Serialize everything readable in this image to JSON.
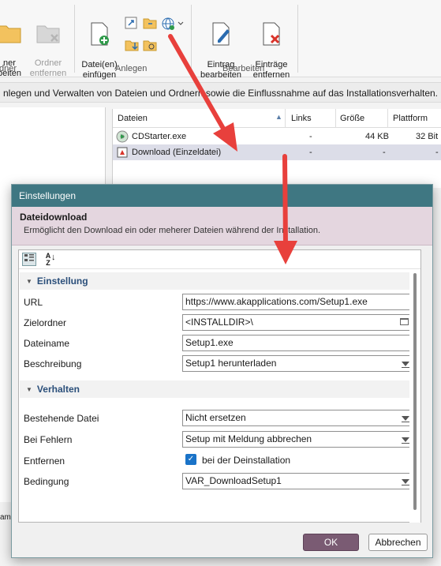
{
  "ribbon": {
    "btn_neuer_ordner": "ner\nbeiten",
    "btn_ordner_entfernen": "Ordner\nentfernen",
    "btn_dateien_einfuegen": "Datei(en)\neinfügen",
    "btn_eintrag_bearbeiten": "Eintrag\nbearbeiten",
    "btn_eintraege_entfernen": "Einträge\nentfernen",
    "group_ordner": "dner",
    "group_anlegen": "Anlegen",
    "group_bearbeiten": "Bearbeiten"
  },
  "description_bar": "nlegen und Verwalten von Dateien und Ordnern sowie die Einflussnahme auf das Installationsverhalten.",
  "file_list": {
    "headers": [
      "Dateien",
      "Links",
      "Größe",
      "Plattform"
    ],
    "rows": [
      {
        "name": "CDStarter.exe",
        "links": "-",
        "size": "44 KB",
        "platform": "32 Bit"
      },
      {
        "name": "Download (Einzeldatei)",
        "links": "-",
        "size": "-",
        "platform": "-"
      }
    ]
  },
  "left_fragment": "amı",
  "dialog": {
    "title": "Einstellungen",
    "header_title": "Dateidownload",
    "header_subtitle": "Ermöglicht den Download ein oder meherer Dateien während der Installation.",
    "categories": {
      "einstellung": "Einstellung",
      "verhalten": "Verhalten"
    },
    "properties": {
      "url": {
        "label": "URL",
        "value": "https://www.akapplications.com/Setup1.exe"
      },
      "zielordner": {
        "label": "Zielordner",
        "value": "<INSTALLDIR>\\"
      },
      "dateiname": {
        "label": "Dateiname",
        "value": "Setup1.exe"
      },
      "beschreibung": {
        "label": "Beschreibung",
        "value": "Setup1 herunterladen"
      },
      "bestehende_datei": {
        "label": "Bestehende Datei",
        "value": "Nicht ersetzen"
      },
      "bei_fehlern": {
        "label": "Bei Fehlern",
        "value": "Setup mit Meldung abbrechen"
      },
      "entfernen": {
        "label": "Entfernen",
        "value": "bei der Deinstallation",
        "checked": true
      },
      "bedingung": {
        "label": "Bedingung",
        "value": "VAR_DownloadSetup1"
      }
    },
    "ok_label": "OK",
    "cancel_label": "Abbrechen",
    "sort_alpha_label": "A Z"
  },
  "colors": {
    "title_bar": "#3f7782",
    "header_bg": "#e4d6df",
    "ok_button": "#7a5b73",
    "arrow": "#e8403c",
    "category_text": "#2b4f7a",
    "checkbox": "#1a73c8"
  }
}
